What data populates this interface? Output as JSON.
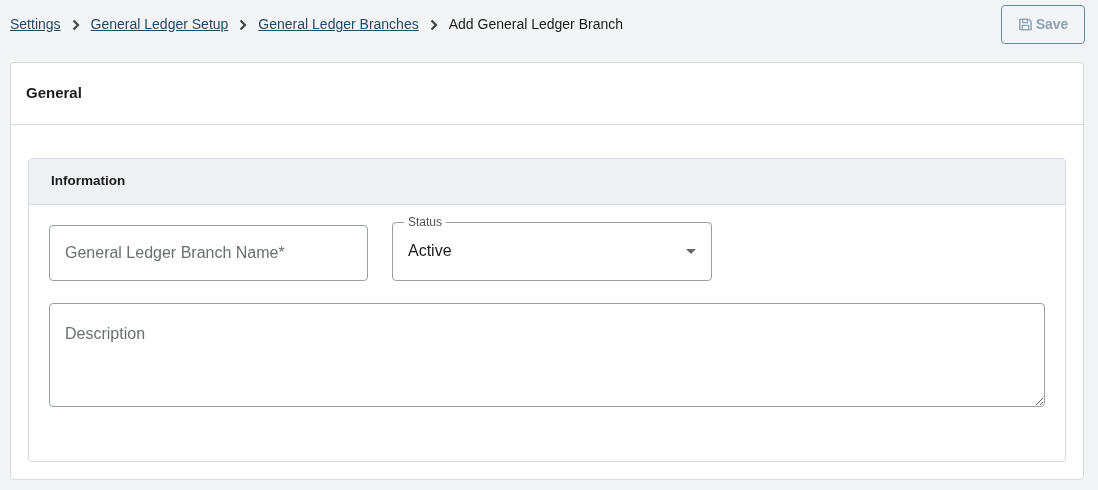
{
  "breadcrumb": [
    {
      "label": "Settings",
      "link": true
    },
    {
      "label": "General Ledger Setup",
      "link": true
    },
    {
      "label": "General Ledger Branches",
      "link": true
    },
    {
      "label": "Add General Ledger Branch",
      "link": false
    }
  ],
  "save_button": {
    "label": "Save",
    "disabled": true
  },
  "card": {
    "title": "General",
    "section": {
      "title": "Information",
      "name_field": {
        "placeholder": "General Ledger Branch Name*"
      },
      "status_field": {
        "label": "Status",
        "value": "Active"
      },
      "description_field": {
        "placeholder": "Description"
      }
    }
  }
}
